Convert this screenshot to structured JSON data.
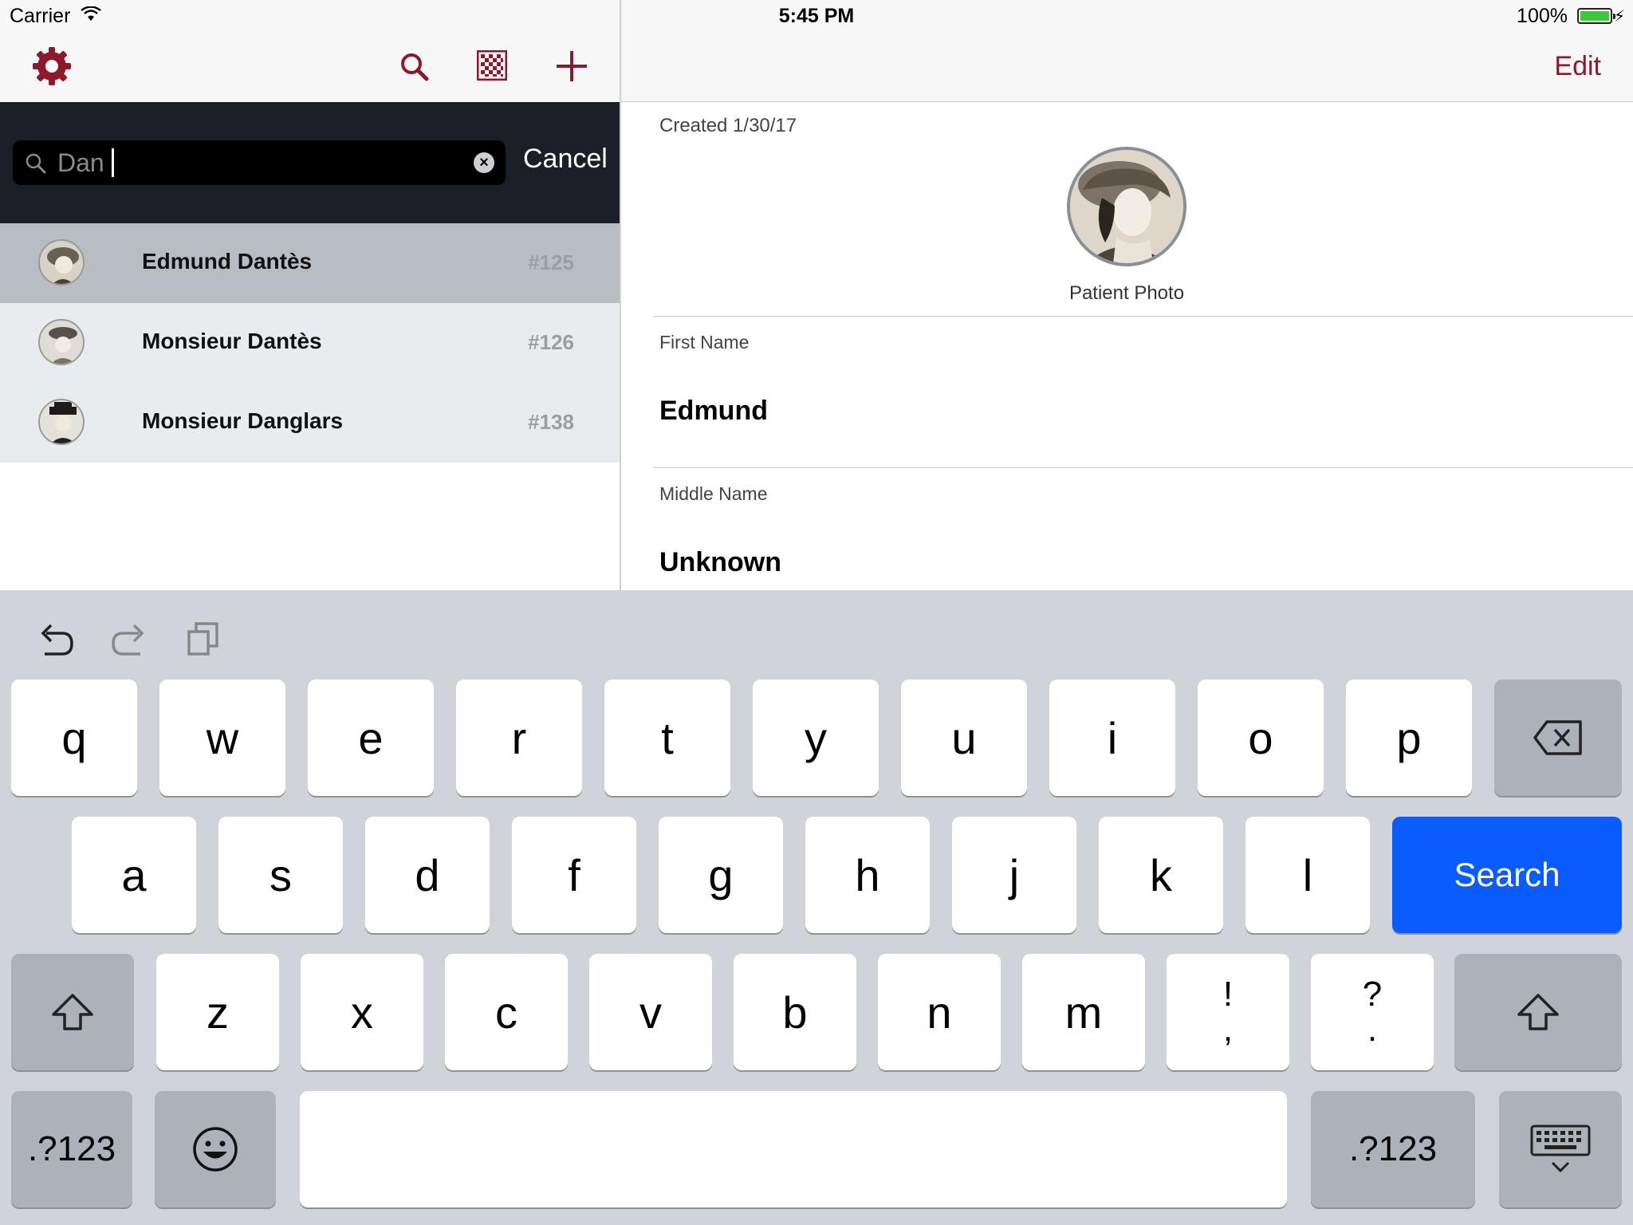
{
  "status_bar": {
    "carrier": "Carrier",
    "time": "5:45 PM",
    "battery": "100%",
    "battery_level": 1.0
  },
  "master": {
    "nav_icons": [
      "gear-icon",
      "search-icon",
      "qr-code-icon",
      "plus-icon"
    ],
    "search": {
      "value": "Dan",
      "cancel_label": "Cancel"
    },
    "results": [
      {
        "name": "Edmund Dantès",
        "number": "#125",
        "selected": true
      },
      {
        "name": "Monsieur Dantès",
        "number": "#126",
        "selected": false
      },
      {
        "name": "Monsieur Danglars",
        "number": "#138",
        "selected": false
      }
    ]
  },
  "detail": {
    "edit_label": "Edit",
    "created": "Created 1/30/17",
    "photo_label": "Patient Photo",
    "fields": [
      {
        "label": "First Name",
        "value": "Edmund"
      },
      {
        "label": "Middle Name",
        "value": "Unknown"
      }
    ]
  },
  "keyboard": {
    "toolbar_icons": [
      "undo-icon",
      "redo-icon",
      "paste-icon"
    ],
    "row1": [
      "q",
      "w",
      "e",
      "r",
      "t",
      "y",
      "u",
      "i",
      "o",
      "p"
    ],
    "row2": [
      "a",
      "s",
      "d",
      "f",
      "g",
      "h",
      "j",
      "k",
      "l"
    ],
    "row3": [
      "z",
      "x",
      "c",
      "v",
      "b",
      "n",
      "m"
    ],
    "punct1": {
      "top": "!",
      "bottom": ","
    },
    "punct2": {
      "top": "?",
      "bottom": "."
    },
    "search_label": "Search",
    "numbers_label": ".?123",
    "accent_color": "#0A5CFF",
    "tint_color": "#8C1A2C"
  }
}
